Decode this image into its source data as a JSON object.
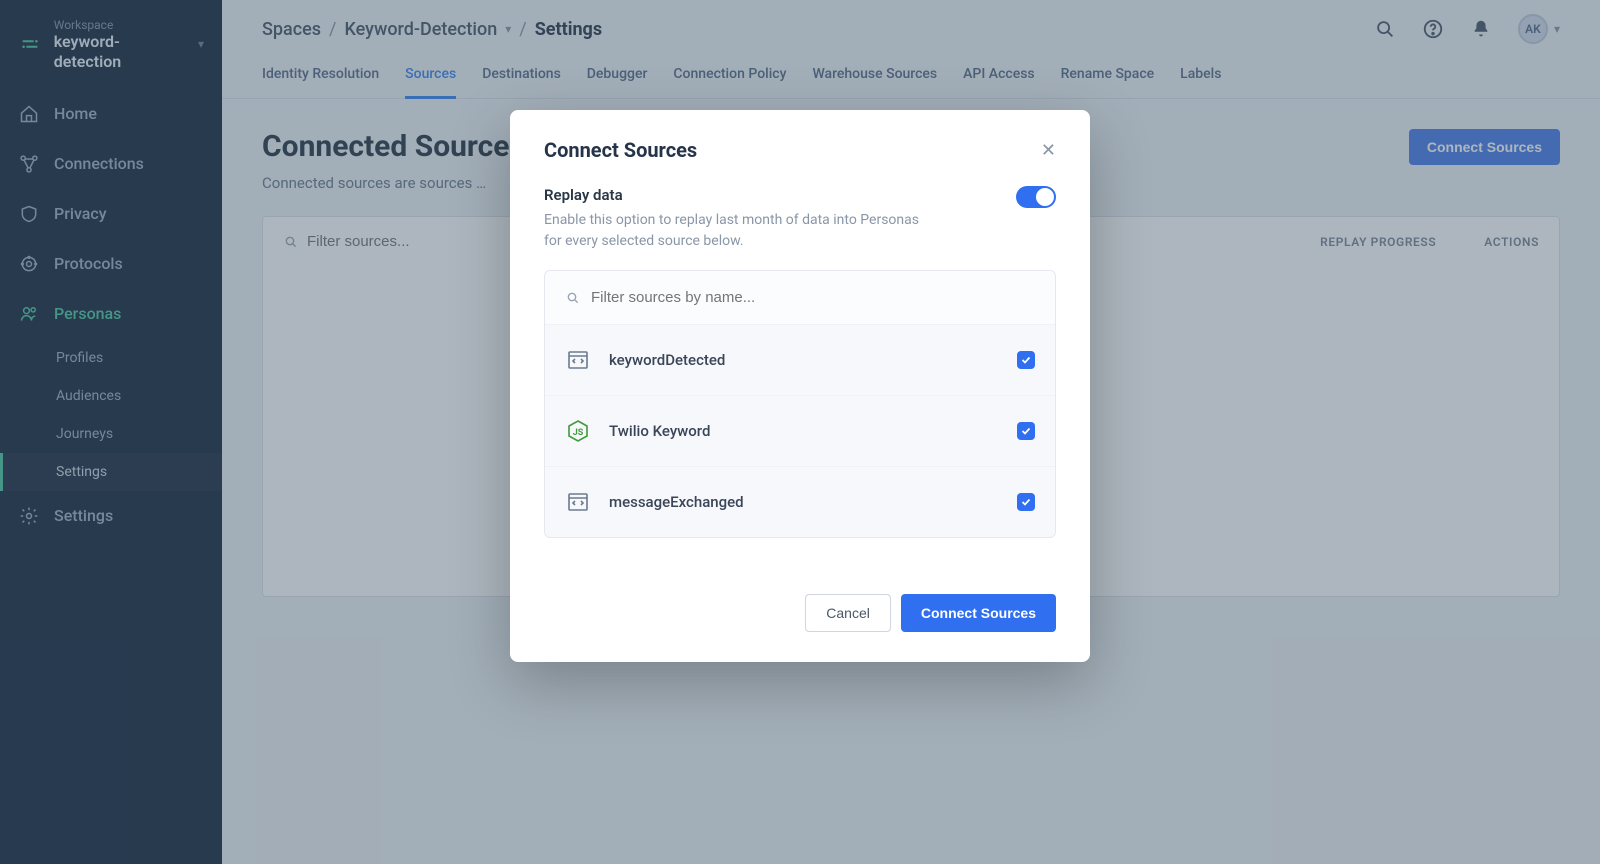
{
  "workspace": {
    "label": "Workspace",
    "name": "keyword-detection"
  },
  "sidebar": {
    "items": [
      {
        "label": "Home",
        "icon": "home"
      },
      {
        "label": "Connections",
        "icon": "connections"
      },
      {
        "label": "Privacy",
        "icon": "shield"
      },
      {
        "label": "Protocols",
        "icon": "protocols"
      },
      {
        "label": "Personas",
        "icon": "personas",
        "active": true
      }
    ],
    "sub": [
      {
        "label": "Profiles"
      },
      {
        "label": "Audiences"
      },
      {
        "label": "Journeys"
      },
      {
        "label": "Settings",
        "selected": true
      }
    ],
    "settings_label": "Settings"
  },
  "breadcrumb": {
    "a": "Spaces",
    "b": "Keyword-Detection",
    "c": "Settings"
  },
  "avatar": "AK",
  "tabs": [
    "Identity Resolution",
    "Sources",
    "Destinations",
    "Debugger",
    "Connection Policy",
    "Warehouse Sources",
    "API Access",
    "Rename Space",
    "Labels"
  ],
  "active_tab_index": 1,
  "page": {
    "title": "Connected Sources",
    "subtitle": "Connected sources are sources …",
    "cta": "Connect Sources",
    "filter_placeholder": "Filter sources...",
    "col1": "REPLAY PROGRESS",
    "col2": "ACTIONS"
  },
  "modal": {
    "title": "Connect Sources",
    "replay_title": "Replay data",
    "replay_desc": "Enable this option to replay last month of data into Personas for every selected source below.",
    "replay_enabled": true,
    "filter_placeholder": "Filter sources by name...",
    "sources": [
      {
        "name": "keywordDetected",
        "icon": "code",
        "checked": true
      },
      {
        "name": "Twilio Keyword",
        "icon": "node",
        "checked": true
      },
      {
        "name": "messageExchanged",
        "icon": "code",
        "checked": true
      }
    ],
    "cancel": "Cancel",
    "confirm": "Connect Sources"
  }
}
